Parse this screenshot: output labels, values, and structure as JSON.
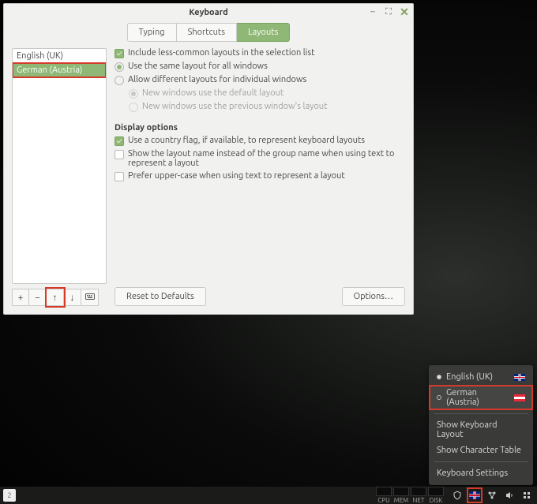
{
  "window": {
    "title": "Keyboard",
    "tabs": {
      "typing": "Typing",
      "shortcuts": "Shortcuts",
      "layouts": "Layouts"
    },
    "layouts": [
      "English (UK)",
      "German (Austria)"
    ],
    "opts": {
      "include_less_common": "Include less-common layouts in the selection list",
      "same_layout": "Use the same layout for all windows",
      "diff_layouts": "Allow different layouts for individual windows",
      "new_default": "New windows use the default layout",
      "new_previous": "New windows use the previous window's layout"
    },
    "display_hdr": "Display options",
    "display": {
      "use_flag": "Use a country flag, if available, to represent keyboard layouts",
      "show_layout_name": "Show the layout name instead of the group name when using text to represent a layout",
      "upper_case": "Prefer upper-case when using text to represent a layout"
    },
    "buttons": {
      "reset": "Reset to Defaults",
      "options": "Options…"
    }
  },
  "popup": {
    "items": [
      {
        "label": "English (UK)",
        "flag": "gb",
        "active": true
      },
      {
        "label": "German (Austria)",
        "flag": "at",
        "active": false
      }
    ],
    "show_layout": "Show Keyboard Layout",
    "show_chartable": "Show Character Table",
    "kb_settings": "Keyboard Settings"
  },
  "taskbar": {
    "graphs": [
      "CPU",
      "MEM",
      "NET",
      "DISK"
    ],
    "workspace": "2"
  }
}
